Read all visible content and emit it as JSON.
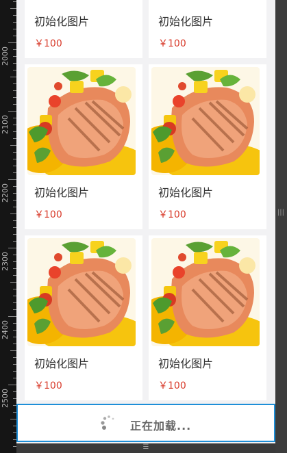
{
  "ruler": {
    "labels": [
      "2000",
      "2100",
      "2200",
      "2300",
      "2400",
      "2500"
    ]
  },
  "products": [
    {
      "title": "初始化图片",
      "price": "￥100",
      "image": "grilled-salmon-photo"
    },
    {
      "title": "初始化图片",
      "price": "￥100",
      "image": "grilled-salmon-photo"
    },
    {
      "title": "初始化图片",
      "price": "￥100",
      "image": "grilled-salmon-photo"
    },
    {
      "title": "初始化图片",
      "price": "￥100",
      "image": "grilled-salmon-photo"
    },
    {
      "title": "初始化图片",
      "price": "￥100",
      "image": "grilled-salmon-photo"
    },
    {
      "title": "初始化图片",
      "price": "￥100",
      "image": "grilled-salmon-photo"
    }
  ],
  "loading": {
    "text": "正在加载...",
    "icon": "spinner-icon"
  },
  "colors": {
    "price": "#d83a2a",
    "accent_border": "#1e8fd8",
    "page_bg": "#f2f2f4"
  }
}
